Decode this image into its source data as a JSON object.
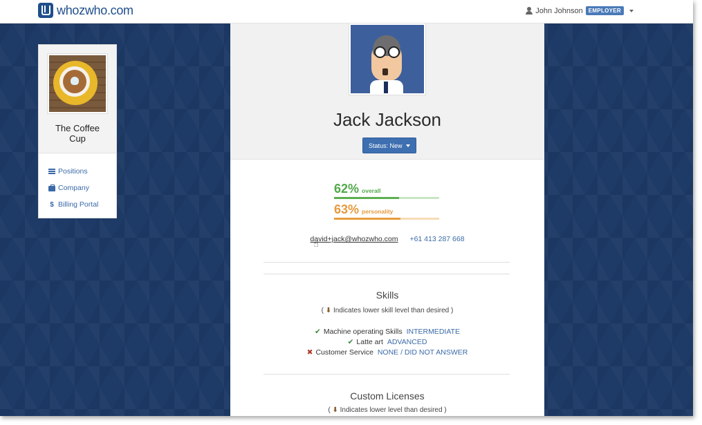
{
  "navbar": {
    "logo_text": "whozwho.com",
    "user_name": "John Johnson",
    "role_badge": "EMPLOYER"
  },
  "company": {
    "name": "The Coffee Cup",
    "nav": [
      {
        "label": "Positions",
        "icon": "list-icon"
      },
      {
        "label": "Company",
        "icon": "briefcase-icon"
      },
      {
        "label": "Billing Portal",
        "icon": "dollar-icon"
      }
    ]
  },
  "candidate": {
    "name": "Jack Jackson",
    "status_label": "Status: New",
    "scores": [
      {
        "value": "62%",
        "label": "overall",
        "fraction": 0.62,
        "color": "#52a84a"
      },
      {
        "value": "63%",
        "label": "personality",
        "fraction": 0.63,
        "color": "#e69a3d"
      }
    ],
    "email": "david+jack@whozwho.com",
    "phone": "+61 413 287 668"
  },
  "skills": {
    "title": "Skills",
    "note_prefix": "(",
    "note": "Indicates lower skill level than desired )",
    "items": [
      {
        "name": "Machine operating Skills",
        "level": "INTERMEDIATE",
        "met": true
      },
      {
        "name": "Latte art",
        "level": "ADVANCED",
        "met": true
      },
      {
        "name": "Customer Service",
        "level": "NONE / DID NOT ANSWER",
        "met": false
      }
    ]
  },
  "licenses": {
    "title": "Custom Licenses",
    "note": "Indicates lower level than desired )"
  },
  "colors": {
    "brand": "#1f4f8b",
    "link": "#3a6aa8",
    "background": "#1f3a66",
    "status_button": "#3e6fb0"
  }
}
